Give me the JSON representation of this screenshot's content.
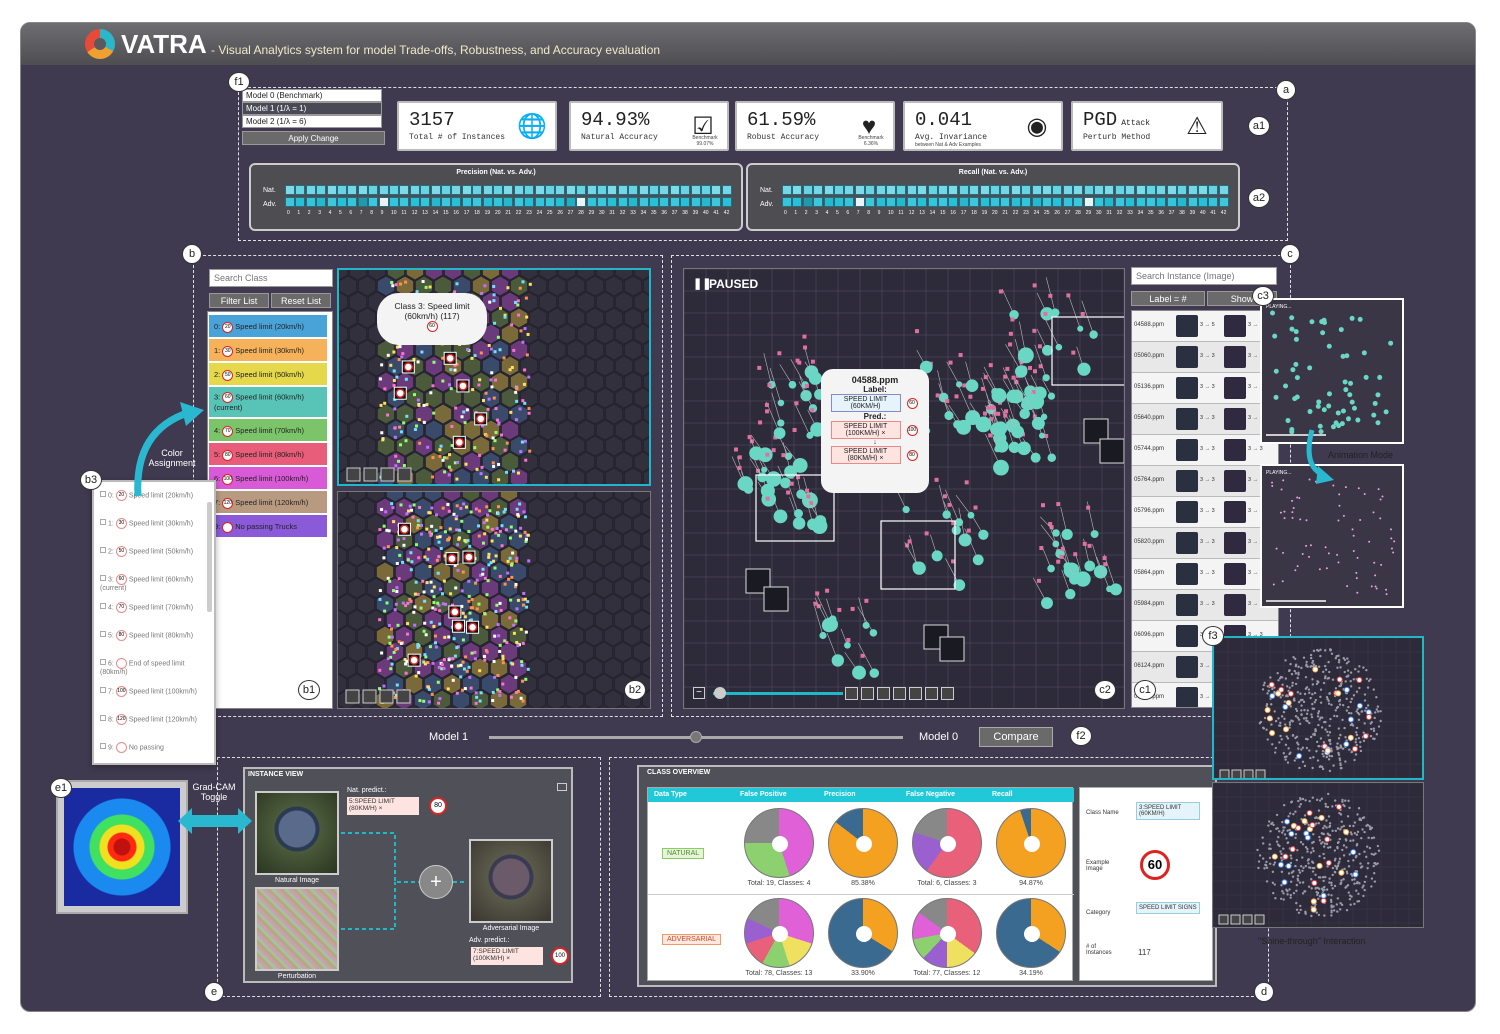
{
  "title": {
    "brand": "VATRA",
    "subtitle": "- Visual Analytics system for model Trade-offs, Robustness, and Accuracy evaluation"
  },
  "badges": {
    "a": "a",
    "a1": "a1",
    "a2": "a2",
    "b": "b",
    "b1": "b1",
    "b2": "b2",
    "b3": "b3",
    "c": "c",
    "c1": "c1",
    "c2": "c2",
    "c3": "c3",
    "d": "d",
    "e": "e",
    "e1": "e1",
    "f1": "f1",
    "f2": "f2",
    "f3": "f3"
  },
  "model_selector": {
    "options": [
      "Model 0 (Benchmark)",
      "Model 1 (1/λ = 1)",
      "Model 2 (1/λ = 6)"
    ],
    "selected_index": 1,
    "apply_label": "Apply Change"
  },
  "stats": [
    {
      "value": "3157",
      "label": "Total # of Instances",
      "icon": "globe-icon",
      "note": ""
    },
    {
      "value": "94.93%",
      "label": "Natural Accuracy",
      "icon": "checkbox-icon",
      "note": "Benchmark 99.07%"
    },
    {
      "value": "61.59%",
      "label": "Robust Accuracy",
      "icon": "heart-alert-icon",
      "note": "Benchmark 6.36%"
    },
    {
      "value": "0.041",
      "label": "Avg. Invariance",
      "sublabel": "between Nat & Adv Examples",
      "icon": "eye-icon",
      "note": ""
    },
    {
      "value": "PGD",
      "value_suffix": "Attack",
      "label": "Perturb Method",
      "icon": "warning-icon",
      "note": ""
    }
  ],
  "heatmaps": {
    "precision_title": "Precision (Nat. vs. Adv.)",
    "recall_title": "Recall (Nat. vs. Adv.)",
    "row_nat": "Nat.",
    "row_adv": "Adv.",
    "num_classes": 43,
    "precision_nat": [
      0.8,
      0.7,
      0.75,
      0.7,
      0.8,
      0.7,
      0.75,
      0.8,
      0.7,
      0.75,
      0.7,
      0.8,
      0.75,
      0.7,
      0.8,
      0.7,
      0.75,
      0.8,
      0.7,
      0.75,
      0.7,
      0.8,
      0.75,
      0.7,
      0.8,
      0.7,
      0.75,
      0.8,
      0.7,
      0.75,
      0.7,
      0.8,
      0.75,
      0.7,
      0.8,
      0.7,
      0.75,
      0.8,
      0.7,
      0.75,
      0.7,
      0.8,
      0.75
    ],
    "precision_adv": [
      0.5,
      0.4,
      0.45,
      0.35,
      0.5,
      0.4,
      0.45,
      0.2,
      0.5,
      0.1,
      0.45,
      0.5,
      0.4,
      0.45,
      0.35,
      0.5,
      0.4,
      0.45,
      0.5,
      0.4,
      0.45,
      0.35,
      0.5,
      0.4,
      0.45,
      0.5,
      0.4,
      0.3,
      0.05,
      0.45,
      0.5,
      0.4,
      0.45,
      0.35,
      0.5,
      0.4,
      0.45,
      0.5,
      0.4,
      0.45,
      0.35,
      0.5,
      0.4
    ],
    "recall_nat": [
      0.75,
      0.8,
      0.7,
      0.75,
      0.8,
      0.7,
      0.75,
      0.8,
      0.7,
      0.75,
      0.8,
      0.7,
      0.75,
      0.8,
      0.7,
      0.75,
      0.8,
      0.7,
      0.75,
      0.8,
      0.7,
      0.75,
      0.8,
      0.7,
      0.75,
      0.8,
      0.7,
      0.75,
      0.8,
      0.7,
      0.75,
      0.8,
      0.7,
      0.75,
      0.8,
      0.7,
      0.75,
      0.8,
      0.7,
      0.75,
      0.8,
      0.7,
      0.75
    ],
    "recall_adv": [
      0.45,
      0.4,
      0.2,
      0.5,
      0.35,
      0.4,
      0.45,
      0.1,
      0.5,
      0.4,
      0.45,
      0.35,
      0.5,
      0.4,
      0.45,
      0.5,
      0.4,
      0.35,
      0.5,
      0.4,
      0.45,
      0.5,
      0.4,
      0.45,
      0.35,
      0.5,
      0.4,
      0.45,
      0.5,
      0.1,
      0.45,
      0.35,
      0.5,
      0.4,
      0.45,
      0.5,
      0.4,
      0.45,
      0.35,
      0.5,
      0.4,
      0.45,
      0.5
    ]
  },
  "class_list": {
    "search_placeholder": "Search Class",
    "filter_label": "Filter List",
    "reset_label": "Reset List",
    "items": [
      {
        "idx": "0:",
        "sign": "20",
        "label": "Speed limit (20km/h)",
        "color": "#4aa3d8"
      },
      {
        "idx": "1:",
        "sign": "30",
        "label": "Speed limit (30km/h)",
        "color": "#f5b25a"
      },
      {
        "idx": "2:",
        "sign": "50",
        "label": "Speed limit (50km/h)",
        "color": "#e5d84a"
      },
      {
        "idx": "3:",
        "sign": "60",
        "label": "Speed limit (60km/h) (current)",
        "color": "#58c4b8"
      },
      {
        "idx": "4:",
        "sign": "70",
        "label": "Speed limit (70km/h)",
        "color": "#7cc46a"
      },
      {
        "idx": "5:",
        "sign": "80",
        "label": "Speed limit (80km/h)",
        "color": "#e85d7a"
      },
      {
        "idx": "6:",
        "sign": "100",
        "label": "Speed limit (100km/h)",
        "color": "#d95ad6"
      },
      {
        "idx": "7:",
        "sign": "120",
        "label": "Speed limit (120km/h)",
        "color": "#b89a80"
      },
      {
        "idx": "9:",
        "sign": "",
        "label": "No passing Trucks",
        "color": "#8a5ad8"
      }
    ]
  },
  "b3_list": [
    {
      "idx": "0:",
      "sign": "20",
      "label": "Speed limit (20km/h)"
    },
    {
      "idx": "1:",
      "sign": "30",
      "label": "Speed limit (30km/h)"
    },
    {
      "idx": "2:",
      "sign": "50",
      "label": "Speed limit (50km/h)"
    },
    {
      "idx": "3:",
      "sign": "60",
      "label": "Speed limit (60km/h) (current)"
    },
    {
      "idx": "4:",
      "sign": "70",
      "label": "Speed limit (70km/h)"
    },
    {
      "idx": "5:",
      "sign": "80",
      "label": "Speed limit (80km/h)"
    },
    {
      "idx": "6:",
      "sign": "",
      "label": "End of speed limit (80km/h)"
    },
    {
      "idx": "7:",
      "sign": "100",
      "label": "Speed limit (100km/h)"
    },
    {
      "idx": "8:",
      "sign": "120",
      "label": "Speed limit (120km/h)"
    },
    {
      "idx": "9:",
      "sign": "",
      "label": "No passing"
    }
  ],
  "annotations": {
    "color_assignment": "Color Assignment",
    "gradcam_toggle": "Grad-CAM Toggle",
    "animation_mode": "Animation Mode",
    "shine_through": "\"Shine-through\" Interaction"
  },
  "hex_tooltip": {
    "line1": "Class 3: Speed limit",
    "line2": "(60km/h) (117)",
    "sign": "60"
  },
  "scatter": {
    "status": "PAUSED",
    "tooltip_file": "04588.ppm",
    "label_title": "Label:",
    "label_value": "SPEED LIMIT (60KM/H)",
    "label_sign": "60",
    "pred_title": "Pred.:",
    "pred_1": "SPEED LIMIT (100KM/H) ×",
    "pred_1_sign": "100",
    "arrow": "↓",
    "pred_2": "SPEED LIMIT (80KM/H) ×",
    "pred_2_sign": "80",
    "slider_value": 0.05
  },
  "instance_list": {
    "search_placeholder": "Search Instance (Image)",
    "label_btn": "Label = #",
    "show_btn": "Show",
    "rows": [
      {
        "id": "04588.ppm",
        "n": "3 → 5",
        "a": "3 → 7"
      },
      {
        "id": "05060.ppm",
        "n": "3 → 3",
        "a": "3 → 3"
      },
      {
        "id": "05136.ppm",
        "n": "3 → 3",
        "a": "3 → 3"
      },
      {
        "id": "05640.ppm",
        "n": "3 → 3",
        "a": "3 → 3"
      },
      {
        "id": "05744.ppm",
        "n": "3 → 3",
        "a": "3 → 3"
      },
      {
        "id": "05764.ppm",
        "n": "3 → 3",
        "a": "3 → 3"
      },
      {
        "id": "05796.ppm",
        "n": "3 → 3",
        "a": "3 → 3"
      },
      {
        "id": "05820.ppm",
        "n": "3 → 3",
        "a": "3 → 3"
      },
      {
        "id": "05864.ppm",
        "n": "3 → 3",
        "a": "3 → 3"
      },
      {
        "id": "05984.ppm",
        "n": "3 → 3",
        "a": "3 → 3"
      },
      {
        "id": "06096.ppm",
        "n": "3 → 3",
        "a": "3 → 3"
      },
      {
        "id": "06124.ppm",
        "n": "3 → 3",
        "a": "3 → 3"
      },
      {
        "id": "06188.ppm",
        "n": "3 → 3",
        "a": "3 → 3"
      }
    ]
  },
  "anim": {
    "playing_label": "PLAYING..."
  },
  "compare": {
    "left": "Model 1",
    "right": "Model 0",
    "button": "Compare",
    "slider_value": 0.5
  },
  "instance_view": {
    "title": "INSTANCE VIEW",
    "nat_title": "Nat. predict.:",
    "nat_pred": "5:SPEED LIMIT (80KM/H) ×",
    "nat_sign": "80",
    "natural_caption": "Natural Image",
    "perturb_caption": "Perturbation",
    "adv_caption": "Adversarial Image",
    "adv_title": "Adv. predict.:",
    "adv_pred": "7:SPEED LIMIT (100KM/H) ×",
    "adv_sign": "100",
    "plus": "+"
  },
  "class_overview": {
    "title": "CLASS OVERVIEW",
    "headers": [
      "Data Type",
      "False Positive",
      "Precision",
      "False Negative",
      "Recall"
    ],
    "natural_label": "NATURAL",
    "adversarial_label": "ADVERSARIAL",
    "natural": [
      {
        "caption": "Total: 19, Classes: 4"
      },
      {
        "caption": "85.38%",
        "value": 0.8538
      },
      {
        "caption": "Total: 6, Classes: 3"
      },
      {
        "caption": "94.87%",
        "value": 0.9487
      }
    ],
    "adversarial": [
      {
        "caption": "Total: 78, Classes: 13"
      },
      {
        "caption": "33.90%",
        "value": 0.339
      },
      {
        "caption": "Total: 77, Classes: 12"
      },
      {
        "caption": "34.19%",
        "value": 0.3419
      }
    ],
    "side": {
      "class_name_label": "Class Name",
      "class_name_value": "3:SPEED LIMIT (60KM/H)",
      "example_label": "Example Image",
      "example_sign": "60",
      "category_label": "Category",
      "category_value": "SPEED LIMIT SIGNS",
      "instances_label": "# of Instances",
      "instances_value": "117"
    }
  },
  "colors": {
    "bg": "#3f3a4f",
    "accent": "#20b8c8",
    "teal_point": "#6ad6c4"
  }
}
